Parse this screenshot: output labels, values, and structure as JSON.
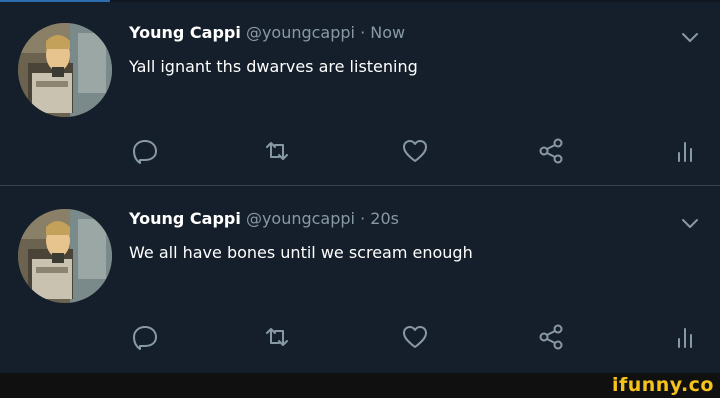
{
  "tweets": [
    {
      "author": "Young Cappi",
      "handle": "@youngcappi",
      "separator": "·",
      "time": "Now",
      "text": "Yall ignant ths dwarves are listening",
      "icons": [
        "reply-icon",
        "retweet-icon",
        "like-icon",
        "share-icon",
        "analytics-icon",
        "chevron-down-icon"
      ]
    },
    {
      "author": "Young Cappi",
      "handle": "@youngcappi",
      "separator": "·",
      "time": "20s",
      "text": "We all have bones until we scream enough",
      "icons": [
        "reply-icon",
        "retweet-icon",
        "like-icon",
        "share-icon",
        "analytics-icon",
        "chevron-down-icon"
      ]
    }
  ],
  "watermark": {
    "text": "ifunny.co"
  },
  "colors": {
    "background": "#151f2b",
    "name": "#ffffff",
    "secondary_text": "#8899a6",
    "divider": "#38444d",
    "watermark": "#f6c21c"
  }
}
